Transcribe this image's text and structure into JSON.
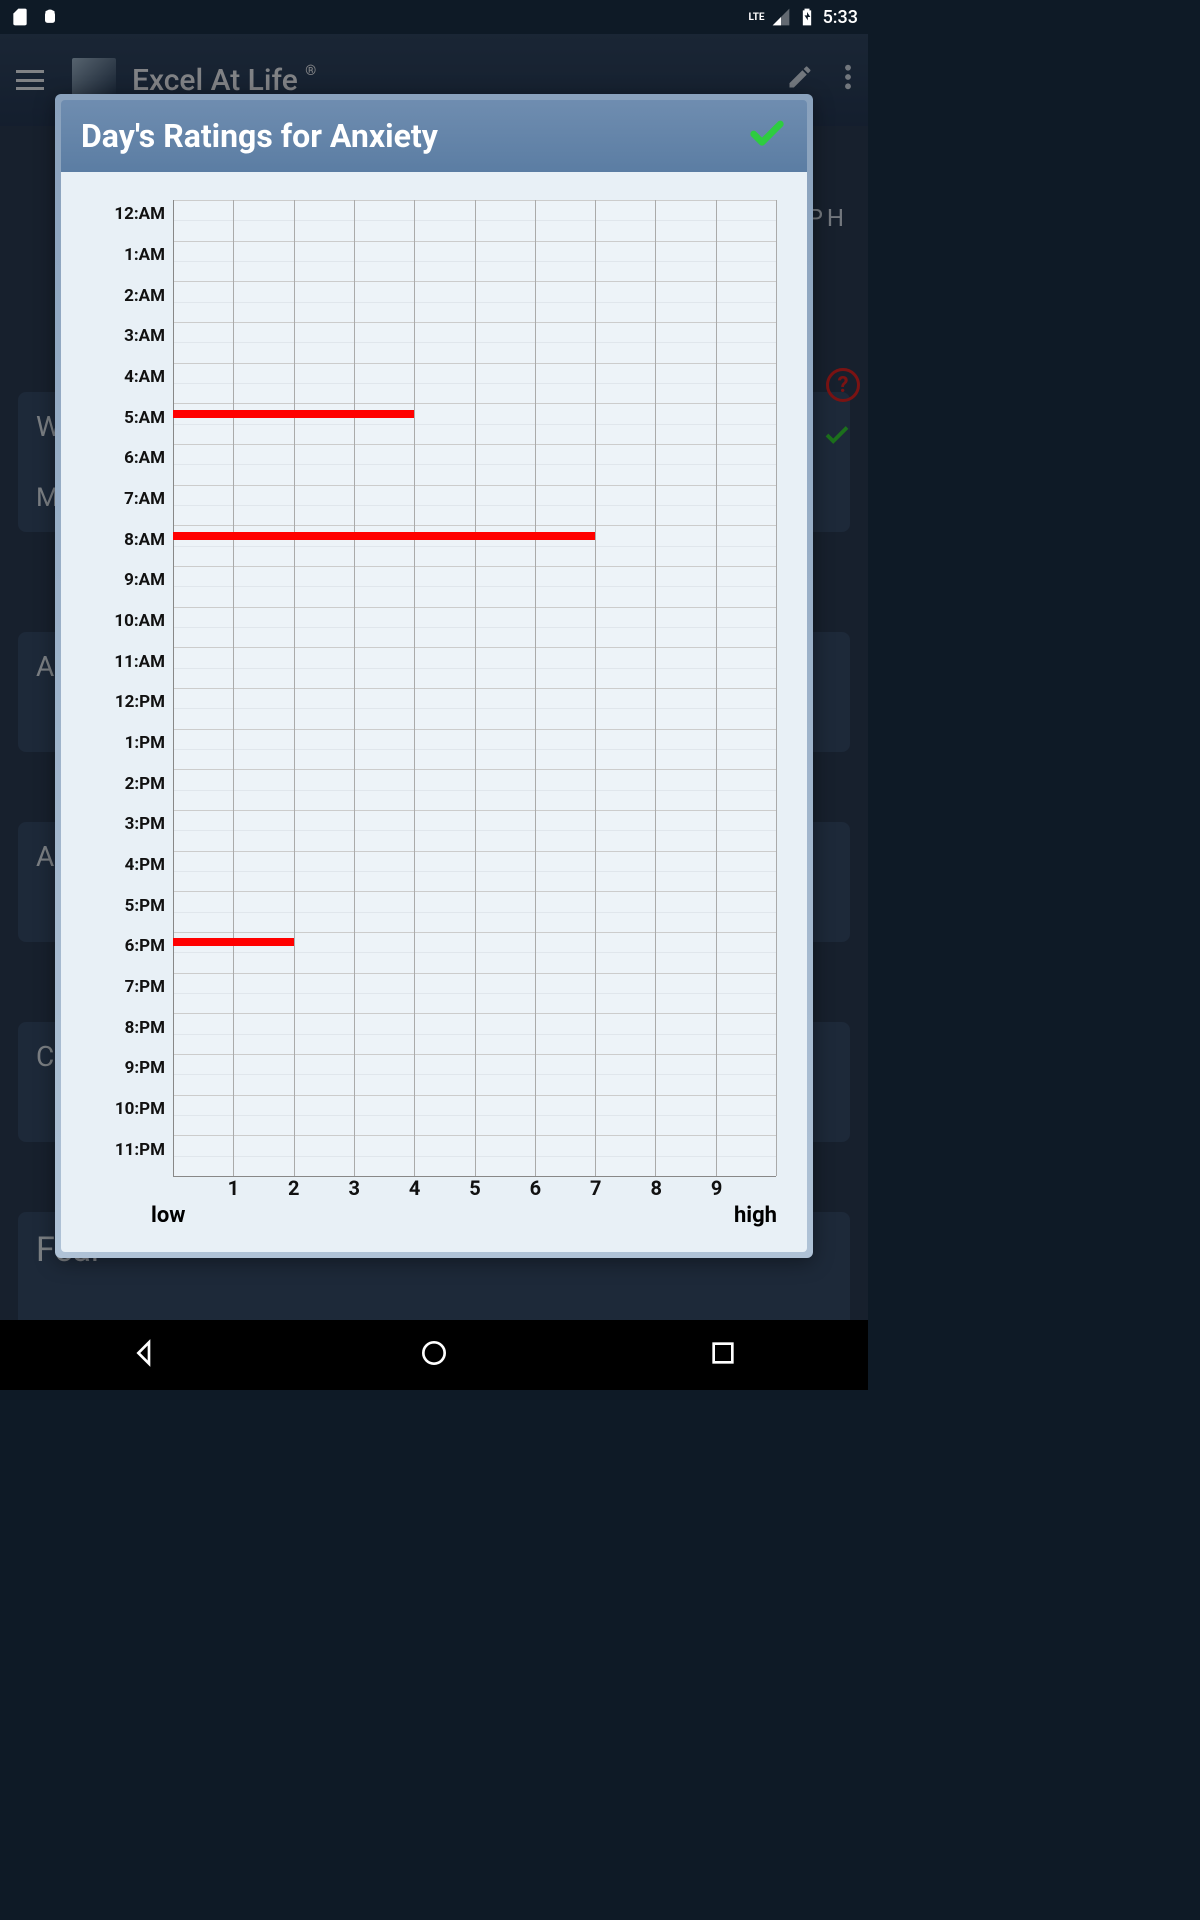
{
  "status": {
    "time": "5:33",
    "lte": "LTE"
  },
  "app": {
    "title": "Excel At Life",
    "trademark": "®"
  },
  "background": {
    "card1_prefix": "W",
    "card1_line": "M",
    "card2_prefix": "A",
    "card3_prefix": "A",
    "card4_prefix": "C",
    "card5_title": "Fear",
    "graph_hint": "APH",
    "help_badge": "?"
  },
  "modal": {
    "title": "Day's Ratings for Anxiety"
  },
  "chart_data": {
    "type": "bar",
    "orientation": "horizontal",
    "title": "Day's Ratings for Anxiety",
    "xlabel_low": "low",
    "xlabel_high": "high",
    "xlim": [
      0,
      10
    ],
    "x_ticks": [
      1,
      2,
      3,
      4,
      5,
      6,
      7,
      8,
      9
    ],
    "y_categories": [
      "12:AM",
      "1:AM",
      "2:AM",
      "3:AM",
      "4:AM",
      "5:AM",
      "6:AM",
      "7:AM",
      "8:AM",
      "9:AM",
      "10:AM",
      "11:AM",
      "12:PM",
      "1:PM",
      "2:PM",
      "3:PM",
      "4:PM",
      "5:PM",
      "6:PM",
      "7:PM",
      "8:PM",
      "9:PM",
      "10:PM",
      "11:PM"
    ],
    "bars": [
      {
        "hour": "5:AM",
        "index_after": 5.25,
        "value": 4
      },
      {
        "hour": "8:AM",
        "index_after": 8.25,
        "value": 7
      },
      {
        "hour": "6:PM",
        "index_after": 18.25,
        "value": 2
      }
    ],
    "bar_color": "#ff0000"
  }
}
